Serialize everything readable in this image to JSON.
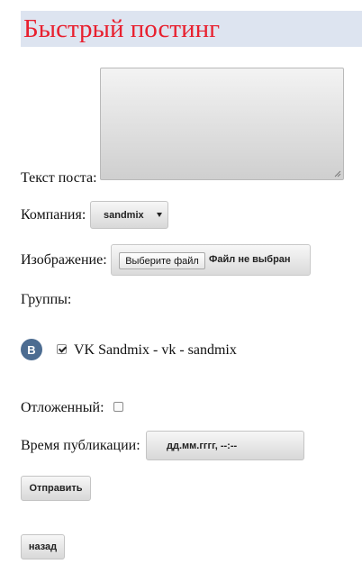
{
  "header": {
    "title": "Быстрый постинг"
  },
  "form": {
    "post_text_label": "Текст поста:",
    "post_text_value": "",
    "company_label": "Компания:",
    "company_selected": "sandmix",
    "image_label": "Изображение:",
    "file_button_label": "Выберите файл",
    "file_status": "Файл не выбран",
    "groups_label": "Группы:",
    "groups": [
      {
        "icon": "vk-icon",
        "icon_text": "В",
        "label": "VK Sandmix - vk - sandmix",
        "checked": true
      }
    ],
    "deferred_label": "Отложенный:",
    "deferred_checked": false,
    "publish_time_label": "Время публикации:",
    "publish_time_placeholder": "дд.мм.гггг, --:--",
    "submit_label": "Отправить",
    "back_label": "назад"
  }
}
